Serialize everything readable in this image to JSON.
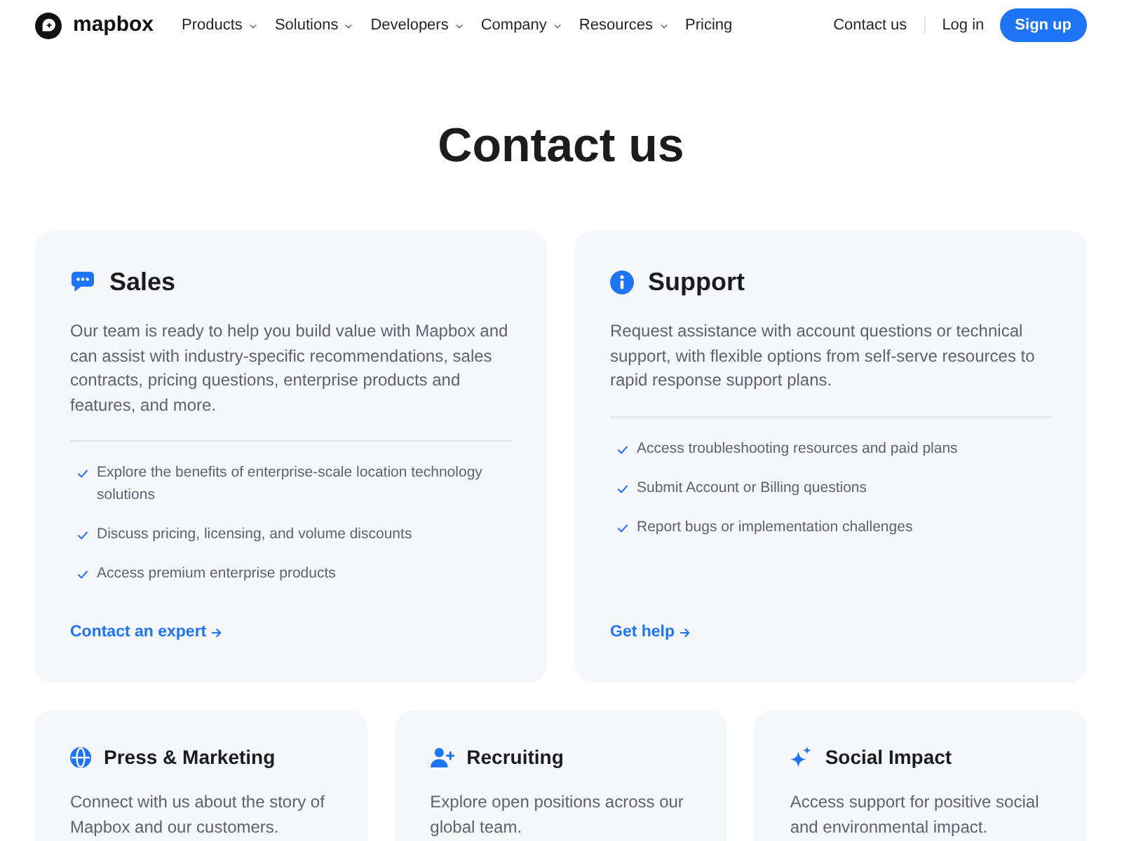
{
  "nav": {
    "logo_text": "mapbox",
    "menu": [
      {
        "label": "Products",
        "dropdown": true
      },
      {
        "label": "Solutions",
        "dropdown": true
      },
      {
        "label": "Developers",
        "dropdown": true
      },
      {
        "label": "Company",
        "dropdown": true
      },
      {
        "label": "Resources",
        "dropdown": true
      },
      {
        "label": "Pricing",
        "dropdown": false
      }
    ],
    "contact_link": "Contact us",
    "login_link": "Log in",
    "signup_button": "Sign up"
  },
  "heading": "Contact us",
  "main_cards": [
    {
      "title": "Sales",
      "description": "Our team is ready to help you build value with Mapbox and can assist with industry-specific recommendations, sales contracts, pricing questions, enterprise products and features, and more.",
      "features": [
        "Explore the benefits of enterprise-scale location technology solutions",
        "Discuss pricing, licensing, and volume discounts",
        "Access premium enterprise products"
      ],
      "link": "Contact an expert"
    },
    {
      "title": "Support",
      "description": "Request assistance with account questions or technical support, with flexible options from self-serve resources to rapid response support plans.",
      "features": [
        "Access troubleshooting resources and paid plans",
        "Submit Account or Billing questions",
        "Report bugs or implementation challenges"
      ],
      "link": "Get help"
    }
  ],
  "more_cards": [
    {
      "title": "Press & Marketing",
      "description": "Connect with us about the story of Mapbox and our customers."
    },
    {
      "title": "Recruiting",
      "description": "Explore open positions across our global team."
    },
    {
      "title": "Social Impact",
      "description": "Access support for positive social and environmental impact."
    }
  ]
}
